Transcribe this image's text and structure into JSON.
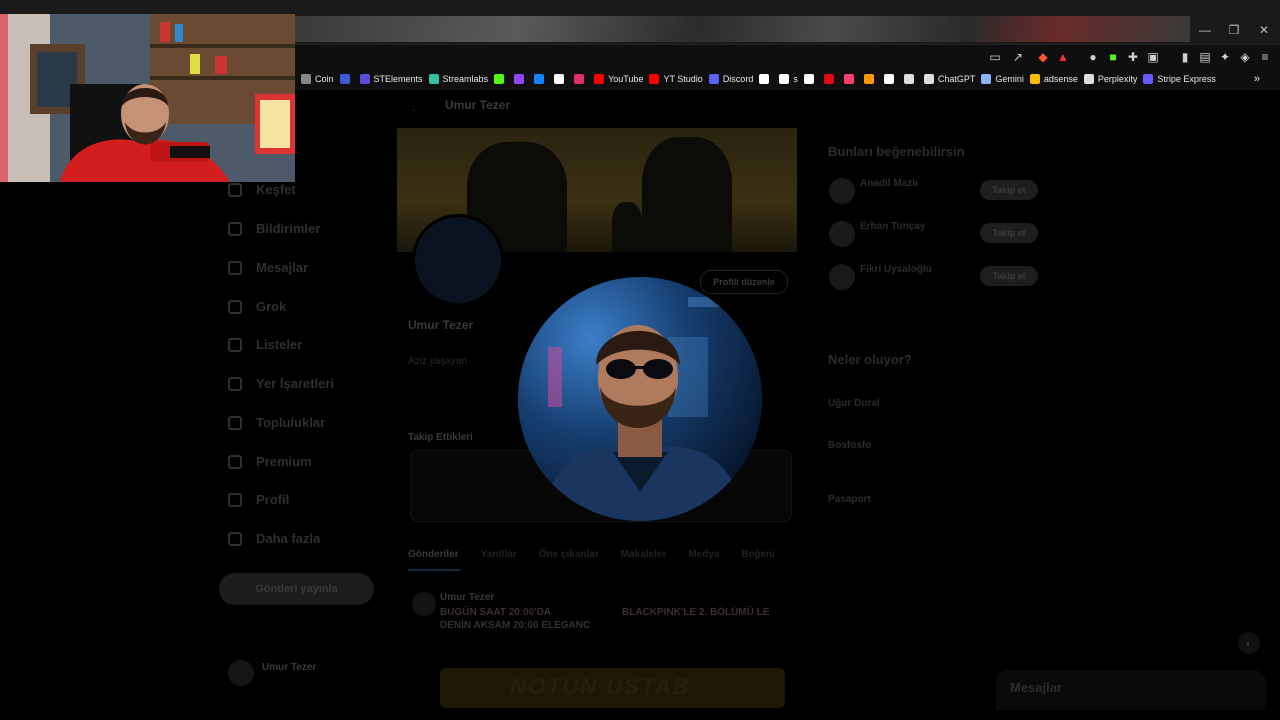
{
  "browser": {
    "window_controls": [
      "—",
      "❐",
      "✕"
    ],
    "bookmarks": [
      {
        "label": "Coin",
        "icon": "folder-icon",
        "color": "#888888"
      },
      {
        "label": "",
        "icon": "r-icon",
        "color": "#3b5bdb"
      },
      {
        "label": "STElements",
        "icon": "st-icon",
        "color": "#5b4bdb"
      },
      {
        "label": "Streamlabs",
        "icon": "streamlabs-icon",
        "color": "#31c3a2"
      },
      {
        "label": "",
        "icon": "kick-icon",
        "color": "#53fc18"
      },
      {
        "label": "",
        "icon": "twitch-icon",
        "color": "#9146ff"
      },
      {
        "label": "",
        "icon": "bluesky-icon",
        "color": "#1185fe"
      },
      {
        "label": "",
        "icon": "x-icon",
        "color": "#ffffff"
      },
      {
        "label": "",
        "icon": "instagram-icon",
        "color": "#e1306c"
      },
      {
        "label": "YouTube",
        "icon": "youtube-icon",
        "color": "#ff0000"
      },
      {
        "label": "YT Studio",
        "icon": "yt-studio-icon",
        "color": "#ff0000"
      },
      {
        "label": "Discord",
        "icon": "discord-icon",
        "color": "#5865f2"
      },
      {
        "label": "",
        "icon": "tiktok-icon",
        "color": "#ffffff"
      },
      {
        "label": "s",
        "icon": "tiktok-studio-icon",
        "color": "#ffffff"
      },
      {
        "label": "",
        "icon": "threads-icon",
        "color": "#ffffff"
      },
      {
        "label": "",
        "icon": "netflix-icon",
        "color": "#e50914"
      },
      {
        "label": "",
        "icon": "app-icon",
        "color": "#ff3e6c"
      },
      {
        "label": "",
        "icon": "app-icon-2",
        "color": "#ff9900"
      },
      {
        "label": "",
        "icon": "amazon-icon",
        "color": "#ffffff"
      },
      {
        "label": "",
        "icon": "claude-icon",
        "color": "#dddddd"
      },
      {
        "label": "ChatGPT",
        "icon": "chatgpt-icon",
        "color": "#dddddd"
      },
      {
        "label": "Gemini",
        "icon": "gemini-icon",
        "color": "#8ab4f8"
      },
      {
        "label": "adsense",
        "icon": "adsense-icon",
        "color": "#fbbc04"
      },
      {
        "label": "Perplexity",
        "icon": "perplexity-icon",
        "color": "#dddddd"
      },
      {
        "label": "Stripe Express",
        "icon": "stripe-icon",
        "color": "#635bff"
      }
    ],
    "more": "»"
  },
  "sidebar": {
    "items": [
      {
        "label": "Keşfet",
        "icon": "search-icon"
      },
      {
        "label": "Bildirimler",
        "icon": "bell-icon"
      },
      {
        "label": "Mesajlar",
        "icon": "mail-icon"
      },
      {
        "label": "Grok",
        "icon": "grok-icon"
      },
      {
        "label": "Listeler",
        "icon": "list-icon"
      },
      {
        "label": "Yer İşaretleri",
        "icon": "bookmark-icon"
      },
      {
        "label": "Topluluklar",
        "icon": "people-icon"
      },
      {
        "label": "Premium",
        "icon": "x-premium-icon"
      },
      {
        "label": "Profil",
        "icon": "person-icon"
      },
      {
        "label": "Daha fazla",
        "icon": "more-icon"
      }
    ],
    "post_button": "Gönderi yayınla",
    "account_name": "Umur Tezer"
  },
  "profile": {
    "header_name": "Umur Tezer",
    "name": "Umur Tezer",
    "edit_button": "Profili düzenle",
    "bio": "Aziz.yaşayan",
    "pinned_label": "Takip Ettikleri",
    "tabs": [
      "Gönderiler",
      "Yanıtlar",
      "Öne çıkanlar",
      "Makaleler",
      "Medya",
      "Beğeni"
    ],
    "post_author": "Umur Tezer",
    "post_text_1": "BUGÜN SAAT 20:00'DA",
    "post_text_2": "BLACKPINK'LE 2. BÖLÜMÜ LE",
    "post_text_3": "DENİN AKSAM 20:00 ELEGANC",
    "post_image_text": "NOTUN USTAB"
  },
  "right": {
    "suggest_title": "Bunları beğenebilirsin",
    "suggestions": [
      {
        "name": "Anadil Mazlı",
        "button": "Takip et"
      },
      {
        "name": "Erhan Tunçay",
        "button": "Takip et"
      },
      {
        "name": "Fikri Uysaloğlu",
        "button": "Takip et"
      }
    ],
    "trend_title": "Neler oluyor?",
    "trends": [
      "Uğur Dural",
      "Bosfosfo",
      "Pasaport"
    ],
    "messages_label": "Mesajlar"
  }
}
